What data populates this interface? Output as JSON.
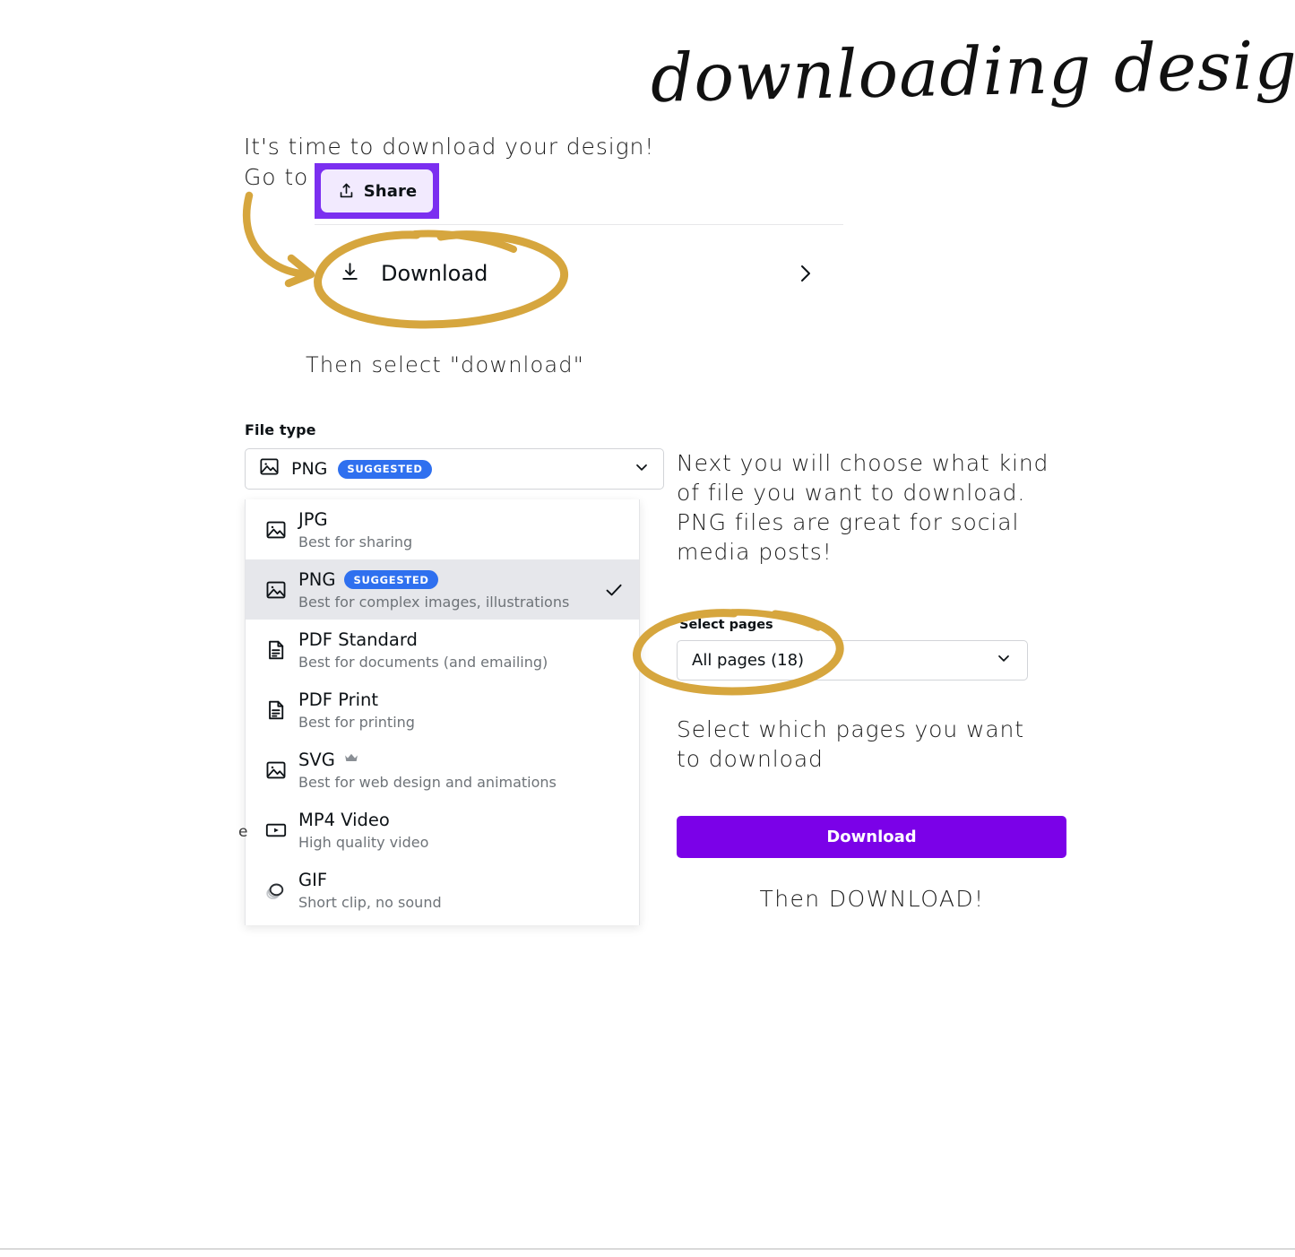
{
  "page": {
    "title_script": "downloading designs",
    "accent_purple": "#7b01e8",
    "accent_purple_border": "#7b2ff0",
    "annotation_gold": "#d6a63e",
    "badge_blue": "#2f70ef"
  },
  "notes": {
    "intro": "It's time to download your design!",
    "go_to": "Go to",
    "then_select": "Then select \"download\"",
    "next_you": "Next you will choose what kind of file you want to download. PNG files are great for social media posts!",
    "select_pages_note": "Select which pages you want to download",
    "then_download": "Then DOWNLOAD!"
  },
  "share_button": {
    "label": "Share",
    "icon": "share-upload-icon"
  },
  "download_menu_row": {
    "label": "Download",
    "icon": "download-arrow-icon",
    "chevron": "chevron-right-icon"
  },
  "file_type": {
    "section_label": "File type",
    "selected_value": "PNG",
    "selected_badge": "SUGGESTED",
    "chevron": "chevron-down-icon",
    "options": [
      {
        "name": "JPG",
        "description": "Best for sharing",
        "icon": "image-icon",
        "badge": "",
        "selected": false,
        "pro": false
      },
      {
        "name": "PNG",
        "description": "Best for complex images, illustrations",
        "icon": "image-icon",
        "badge": "SUGGESTED",
        "selected": true,
        "pro": false
      },
      {
        "name": "PDF Standard",
        "description": "Best for documents (and emailing)",
        "icon": "document-icon",
        "badge": "",
        "selected": false,
        "pro": false
      },
      {
        "name": "PDF Print",
        "description": "Best for printing",
        "icon": "document-icon",
        "badge": "",
        "selected": false,
        "pro": false
      },
      {
        "name": "SVG",
        "description": "Best for web design and animations",
        "icon": "image-icon",
        "badge": "",
        "selected": false,
        "pro": true
      },
      {
        "name": "MP4 Video",
        "description": "High quality video",
        "icon": "video-icon",
        "badge": "",
        "selected": false,
        "pro": false
      },
      {
        "name": "GIF",
        "description": "Short clip, no sound",
        "icon": "gif-icon",
        "badge": "",
        "selected": false,
        "pro": false
      }
    ]
  },
  "select_pages": {
    "label": "Select pages",
    "value": "All pages (18)",
    "chevron": "chevron-down-icon"
  },
  "download_cta": {
    "label": "Download"
  },
  "stray_text": {
    "clipped_char": "e"
  }
}
